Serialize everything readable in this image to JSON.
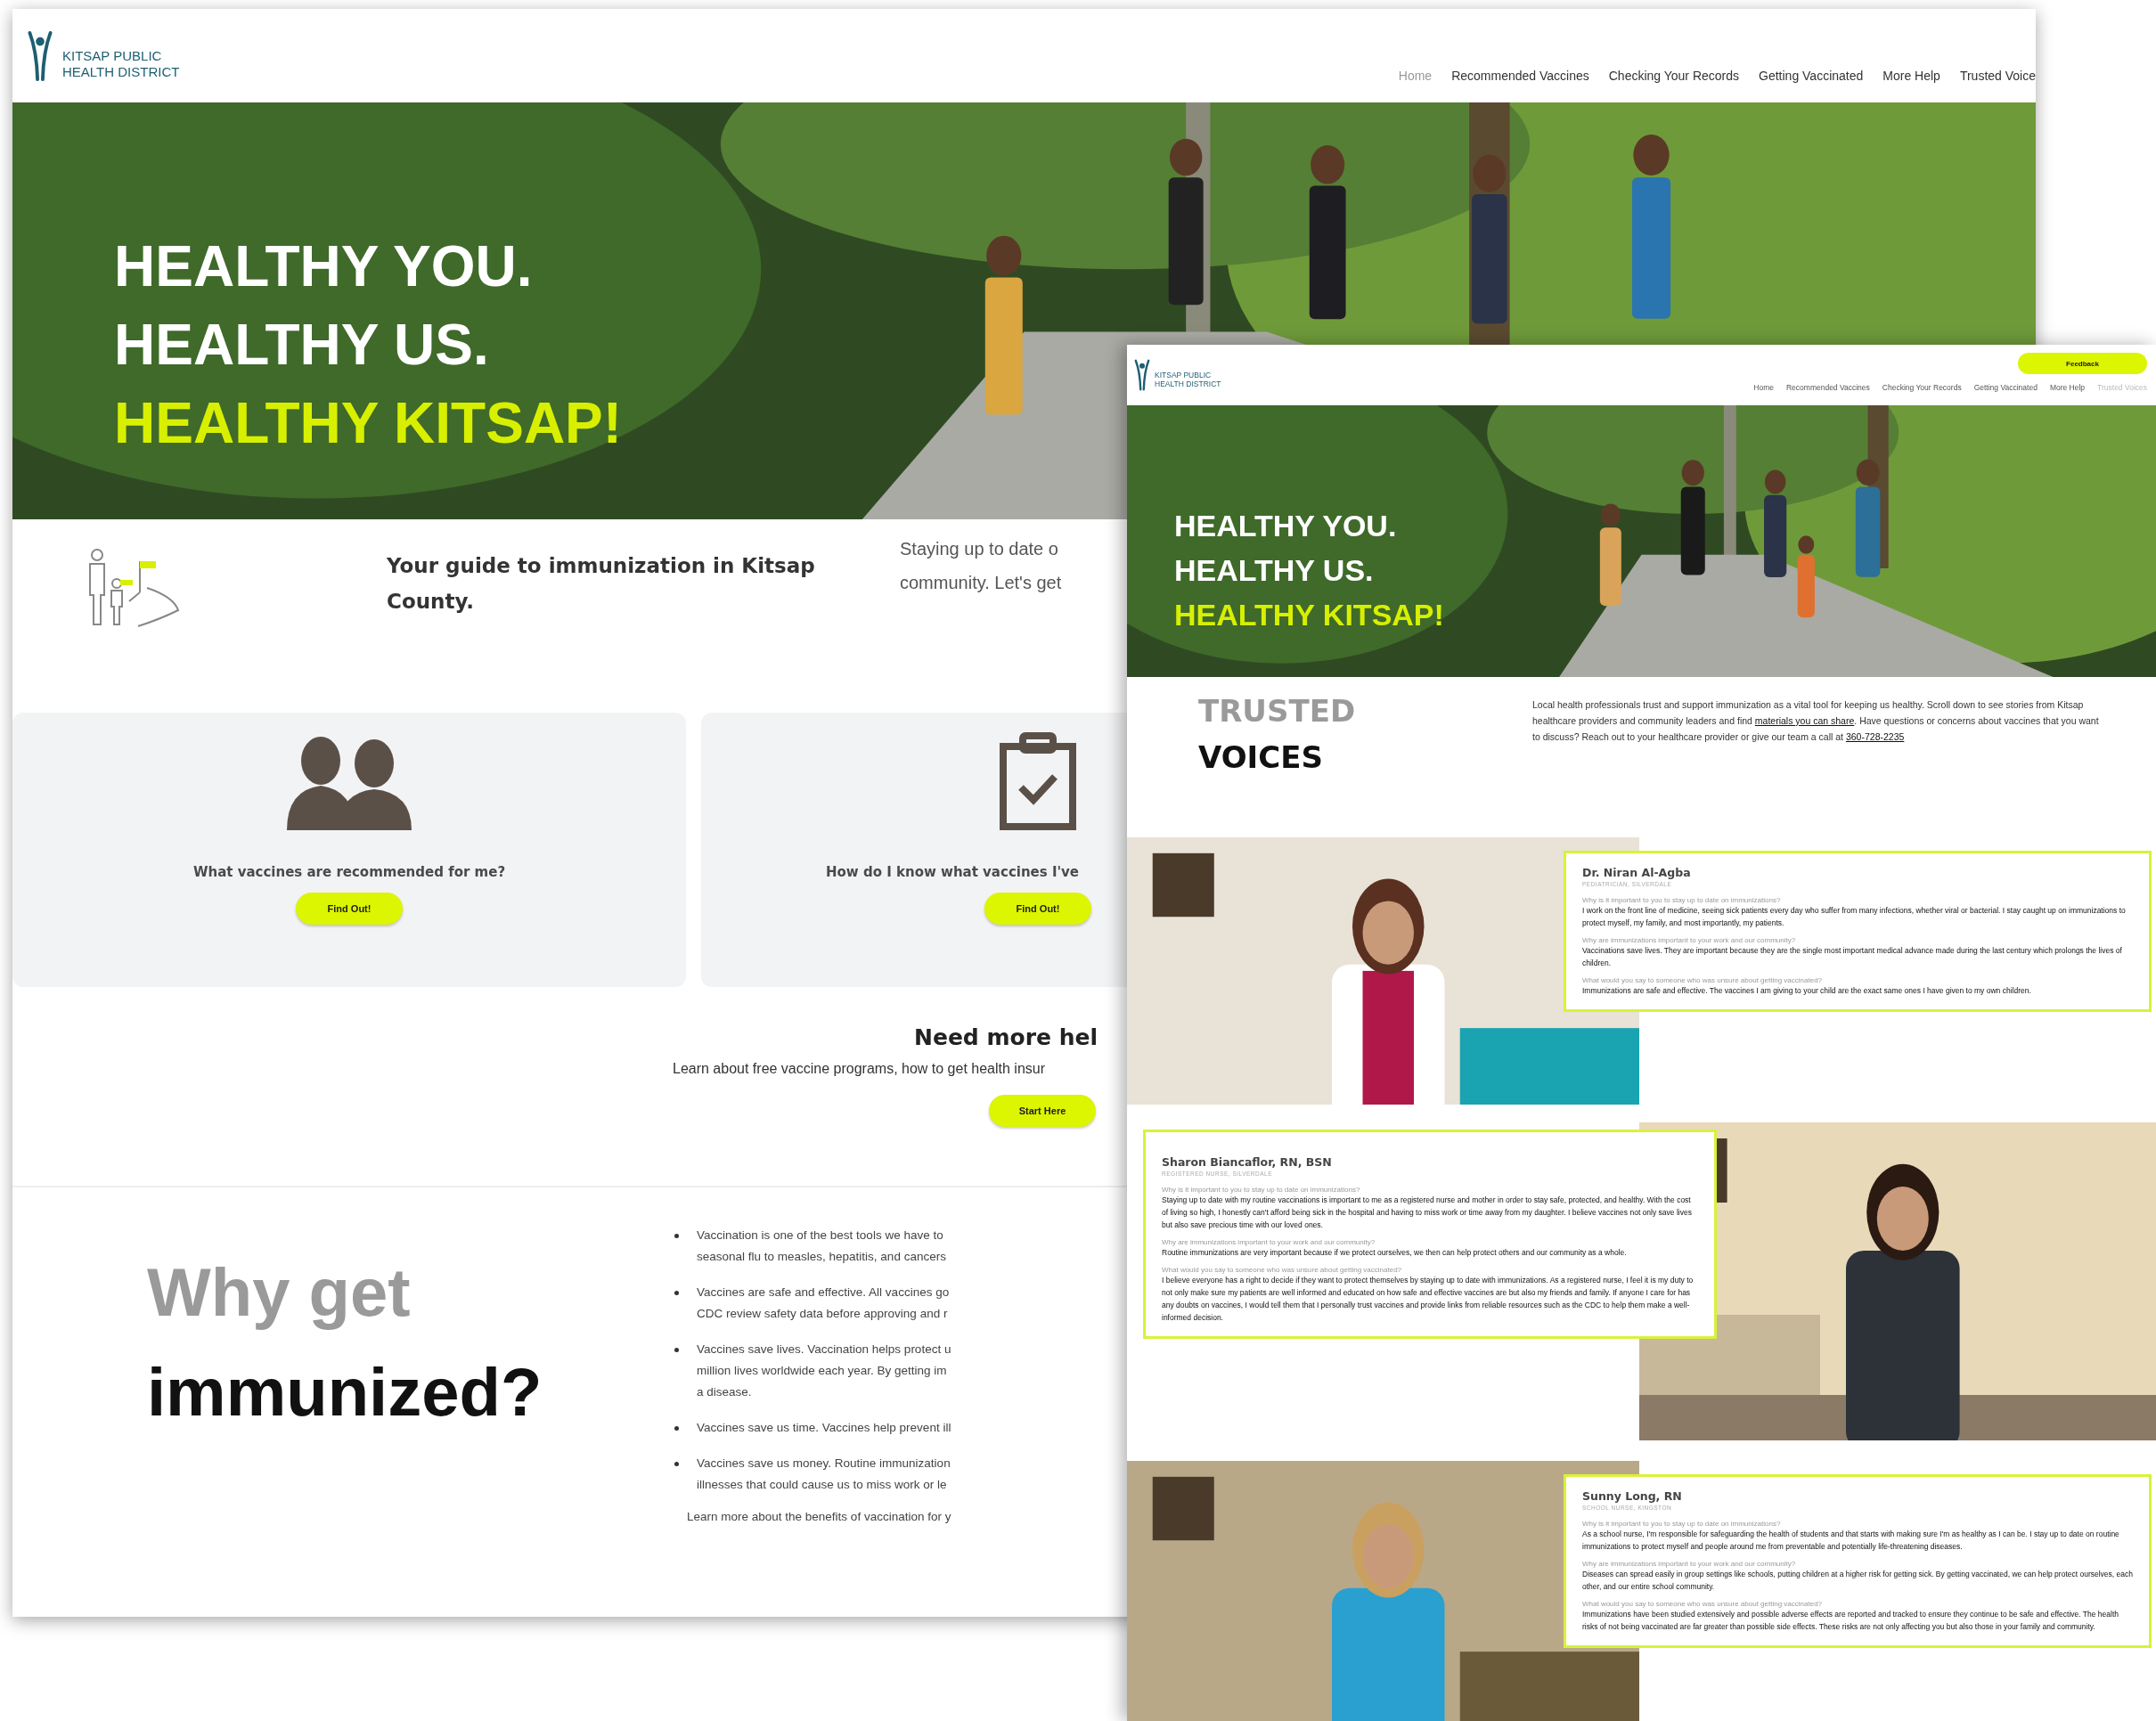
{
  "home_page": {
    "logo_text": [
      "KITSAP PUBLIC",
      "HEALTH DISTRICT"
    ],
    "nav": [
      {
        "label": "Home",
        "selected": true
      },
      {
        "label": "Recommended Vaccines",
        "selected": false
      },
      {
        "label": "Checking Your Records",
        "selected": false
      },
      {
        "label": "Getting Vaccinated",
        "selected": false
      },
      {
        "label": "More Help",
        "selected": false
      },
      {
        "label": "Trusted Voice",
        "selected": false
      }
    ],
    "hero": {
      "headline": [
        {
          "text": "HEALTHY YOU.",
          "highlight": false
        },
        {
          "text": "HEALTHY US.",
          "highlight": false
        },
        {
          "text": "HEALTHY KITSAP!",
          "highlight": true
        }
      ]
    },
    "intro": {
      "title": "Your guide to immunization in Kitsap County.",
      "text_lines": [
        "Staying up to date o",
        "community. Let's get"
      ]
    },
    "cards": [
      {
        "kind": "people",
        "question": "What vaccines are recommended for me?",
        "button": "Find Out!"
      },
      {
        "kind": "clipboard",
        "question": "How do I know what vaccines I've",
        "button": "Find Out!"
      }
    ],
    "more_help": {
      "heading": "Need more hel",
      "text": "Learn about free vaccine programs, how to get health insur",
      "button": "Start Here"
    },
    "why": {
      "heading": [
        {
          "text": "Why get",
          "muted": true
        },
        {
          "text": "immunized?",
          "muted": false
        }
      ],
      "bullets": [
        {
          "lines": [
            "Vaccination is one of the best tools we have to",
            "seasonal flu to measles, hepatitis, and cancers"
          ]
        },
        {
          "lines": [
            "Vaccines are safe and effective. All vaccines go",
            "CDC review safety data before approving and r"
          ]
        },
        {
          "lines": [
            "Vaccines save lives. Vaccination helps protect u",
            "million lives worldwide each year. By getting im",
            "a disease."
          ]
        },
        {
          "lines": [
            "Vaccines save us time. Vaccines help prevent ill"
          ]
        },
        {
          "lines": [
            "Vaccines save us money. Routine immunization",
            "illnesses that could cause us to miss work or le"
          ]
        }
      ],
      "footer": "Learn more about the benefits of vaccination for y"
    }
  },
  "trusted_voices_page": {
    "logo_text": [
      "KITSAP PUBLIC",
      "HEALTH DISTRICT"
    ],
    "feedback_button": "Feedback",
    "nav": [
      {
        "label": "Home",
        "selected": false
      },
      {
        "label": "Recommended Vaccines",
        "selected": false
      },
      {
        "label": "Checking Your Records",
        "selected": false
      },
      {
        "label": "Getting Vaccinated",
        "selected": false
      },
      {
        "label": "More Help",
        "selected": false
      },
      {
        "label": "Trusted Voices",
        "selected": true
      }
    ],
    "hero": {
      "headline": [
        {
          "text": "HEALTHY YOU.",
          "highlight": false
        },
        {
          "text": "HEALTHY US.",
          "highlight": false
        },
        {
          "text": "HEALTHY KITSAP!",
          "highlight": true
        }
      ]
    },
    "heading": [
      {
        "text": "TRUSTED",
        "muted": true
      },
      {
        "text": "VOICES",
        "muted": false
      }
    ],
    "intro_segments": [
      {
        "text": "Local health professionals trust and support immunization as a vital tool for keeping us healthy. Scroll down to see stories from Kitsap healthcare providers and community leaders and find ",
        "kind": "text"
      },
      {
        "text": "materials you can share",
        "kind": "link"
      },
      {
        "text": ". Have questions or concerns about vaccines that you want to discuss? Reach out to your healthcare provider or give our team a call at ",
        "kind": "text"
      },
      {
        "text": "360-728-2235",
        "kind": "link"
      }
    ],
    "voices": [
      {
        "name": "Dr. Niran Al-Agba",
        "role": "PEDIATRICIAN, SILVERDALE",
        "qa": [
          {
            "question": "Why is it important to you to stay up to date on immunizations?",
            "answer": "I work on the front line of medicine, seeing sick patients every day who suffer from many infections, whether viral or bacterial. I stay caught up on immunizations to protect myself, my family, and most importantly, my patients."
          },
          {
            "question": "Why are immunizations important to your work and our community?",
            "answer": "Vaccinations save lives. They are important because they are the single most important medical advance made during the last century which prolongs the lives of children."
          },
          {
            "question": "What would you say to someone who was unsure about getting vaccinated?",
            "answer": "Immunizations are safe and effective. The vaccines I am giving to your child are the exact same ones I have given to my own children."
          }
        ]
      },
      {
        "name": "Sharon Biancaflor, RN, BSN",
        "role": "REGISTERED NURSE, SILVERDALE",
        "qa": [
          {
            "question": "Why is it important to you to stay up to date on immunizations?",
            "answer": "Staying up to date with my routine vaccinations is important to me as a registered nurse and mother in order to stay safe, protected, and healthy. With the cost of living so high, I honestly can't afford being sick in the hospital and having to miss work or time away from my daughter. I believe vaccines not only save lives but also save precious time with our loved ones."
          },
          {
            "question": "Why are immunizations important to your work and our community?",
            "answer": "Routine immunizations are very important because if we protect ourselves, we then can help protect others and our community as a whole."
          },
          {
            "question": "What would you say to someone who was unsure about getting vaccinated?",
            "answer": "I believe everyone has a right to decide if they want to protect themselves by staying up to date with immunizations. As a registered nurse, I feel it is my duty to not only make sure my patients are well informed and educated on how safe and effective vaccines are but also my friends and family. If anyone I care for has any doubts on vaccines, I would tell them that I personally trust vaccines and provide links from reliable resources such as the CDC to help them make a well-informed decision."
          }
        ]
      },
      {
        "name": "Sunny Long, RN",
        "role": "SCHOOL NURSE, KINGSTON",
        "qa": [
          {
            "question": "Why is it important to you to stay up to date on immunizations?",
            "answer": "As a school nurse, I'm responsible for safeguarding the health of students and that starts with making sure I'm as healthy as I can be. I stay up to date on routine immunizations to protect myself and people around me from preventable and potentially life-threatening diseases."
          },
          {
            "question": "Why are immunizations important to your work and our community?",
            "answer": "Diseases can spread easily in group settings like schools, putting children at a higher risk for getting sick. By getting vaccinated, we can help protect ourselves, each other, and our entire school community."
          },
          {
            "question": "What would you say to someone who was unsure about getting vaccinated?",
            "answer": "Immunizations have been studied extensively and possible adverse effects are reported and tracked to ensure they continue to be safe and effective. The health risks of not being vaccinated are far greater than possible side effects. These risks are not only affecting you but also those in your family and community."
          }
        ]
      }
    ]
  }
}
